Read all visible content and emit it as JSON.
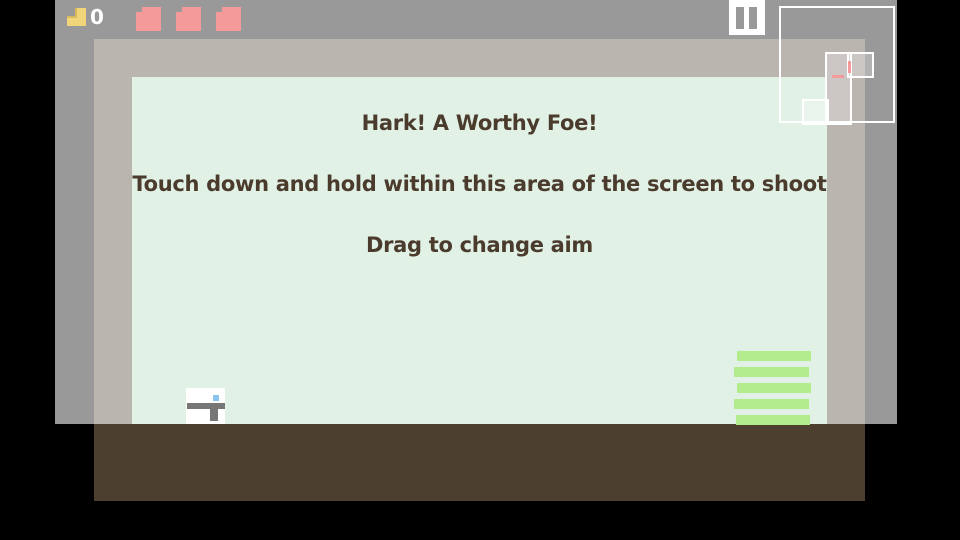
{
  "hud": {
    "coin_count": "0",
    "coin_icon": "coin-icon",
    "hearts": 3,
    "heart_color": "#f59a9a",
    "pause_icon": "pause-icon"
  },
  "tutorial": {
    "title": "Hark! A Worthy Foe!",
    "instruction": "Touch down and hold within this area of the screen to shoot",
    "hint": "Drag to change aim"
  },
  "colors": {
    "room_background": "#e1f1e6",
    "wall": "#bbb5b0",
    "floor": "#4d3f30",
    "text": "#4a3b2c",
    "enemy": "#b2ec8d"
  }
}
